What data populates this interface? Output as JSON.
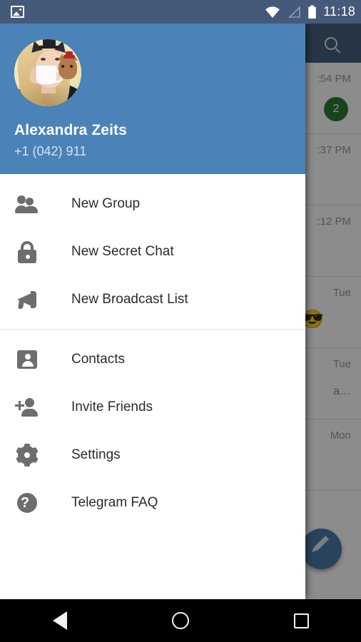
{
  "status_bar": {
    "time": "11:18",
    "icons": [
      "photo-icon",
      "wifi-icon",
      "signal-icon",
      "battery-icon"
    ]
  },
  "app": {
    "toolbar": {
      "search_icon": "search-icon"
    },
    "fab": {
      "icon": "pencil-icon",
      "color": "#4b7ba8"
    },
    "chat_rows": [
      {
        "time": ":54 PM",
        "badge": "2",
        "preview": "",
        "emoji": ""
      },
      {
        "time": ":37 PM",
        "badge": "",
        "preview": "",
        "emoji": ""
      },
      {
        "time": ":12 PM",
        "badge": "",
        "preview": "",
        "emoji": ""
      },
      {
        "time": "Tue",
        "badge": "",
        "preview": "",
        "emoji": "😎"
      },
      {
        "time": "Tue",
        "badge": "",
        "preview": "a…",
        "emoji": ""
      },
      {
        "time": "Mon",
        "badge": "",
        "preview": "",
        "emoji": ""
      }
    ],
    "badge_color": "#2f7d32"
  },
  "drawer": {
    "header": {
      "name": "Alexandra Zeits",
      "phone": "+1 (042) 911",
      "avatar": "user-avatar",
      "background_color": "#4b82b8"
    },
    "groups": [
      {
        "items": [
          {
            "label": "New Group",
            "icon": "people-icon"
          },
          {
            "label": "New Secret Chat",
            "icon": "lock-icon"
          },
          {
            "label": "New Broadcast List",
            "icon": "megaphone-icon"
          }
        ]
      },
      {
        "items": [
          {
            "label": "Contacts",
            "icon": "contact-card-icon"
          },
          {
            "label": "Invite Friends",
            "icon": "person-add-icon"
          },
          {
            "label": "Settings",
            "icon": "gear-icon"
          },
          {
            "label": "Telegram FAQ",
            "icon": "help-circle-icon"
          }
        ]
      }
    ]
  },
  "nav_bar": {
    "back": "back-triangle-icon",
    "home": "home-circle-icon",
    "recents": "recents-square-icon"
  }
}
